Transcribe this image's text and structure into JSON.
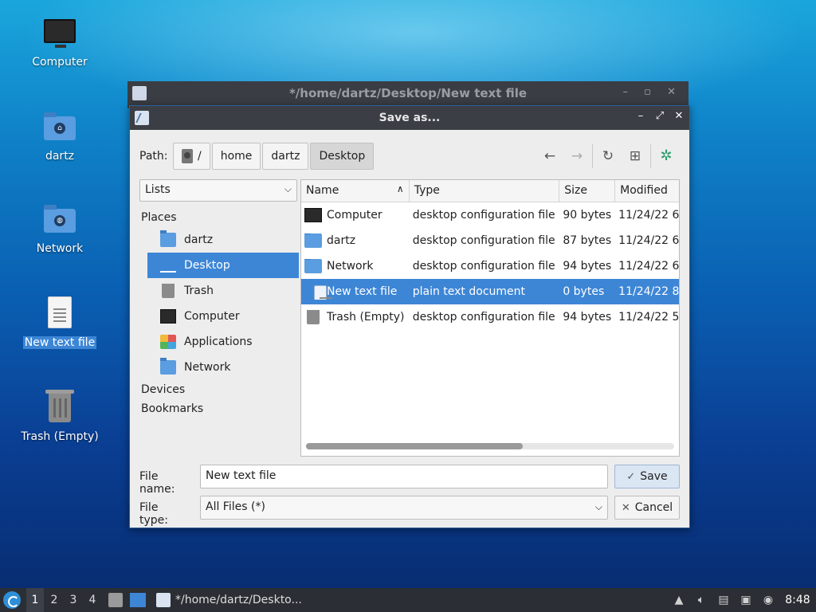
{
  "desktop": {
    "icons": [
      {
        "label": "Computer"
      },
      {
        "label": "dartz"
      },
      {
        "label": "Network"
      },
      {
        "label": "New text file"
      },
      {
        "label": "Trash (Empty)"
      }
    ]
  },
  "background_window": {
    "title": "*/home/dartz/Desktop/New text file"
  },
  "dialog": {
    "title": "Save as...",
    "path_label": "Path:",
    "crumbs": [
      "/",
      "home",
      "dartz",
      "Desktop"
    ],
    "places_view": "Lists",
    "places_header": "Places",
    "places": [
      "dartz",
      "Desktop",
      "Trash",
      "Computer",
      "Applications",
      "Network"
    ],
    "devices_header": "Devices",
    "bookmarks_header": "Bookmarks",
    "columns": {
      "name": "Name",
      "type": "Type",
      "size": "Size",
      "modified": "Modified"
    },
    "files": [
      {
        "name": "Computer",
        "type": "desktop configuration file",
        "size": "90 bytes",
        "modified": "11/24/22 6:"
      },
      {
        "name": "dartz",
        "type": "desktop configuration file",
        "size": "87 bytes",
        "modified": "11/24/22 6:"
      },
      {
        "name": "Network",
        "type": "desktop configuration file",
        "size": "94 bytes",
        "modified": "11/24/22 6:"
      },
      {
        "name": "New text file",
        "type": "plain text document",
        "size": "0 bytes",
        "modified": "11/24/22 8:"
      },
      {
        "name": "Trash (Empty)",
        "type": "desktop configuration file",
        "size": "94 bytes",
        "modified": "11/24/22 5:"
      }
    ],
    "file_name_label": "File name:",
    "file_name_value": "New text file",
    "file_type_label": "File type:",
    "file_type_value": "All Files (*)",
    "save_label": "Save",
    "cancel_label": "Cancel"
  },
  "taskbar": {
    "workspaces": [
      "1",
      "2",
      "3",
      "4"
    ],
    "task_title": "*/home/dartz/Deskto...",
    "clock": "8:48"
  },
  "colors": {
    "selection": "#3d86d6",
    "titlebar": "#3b3e45"
  }
}
